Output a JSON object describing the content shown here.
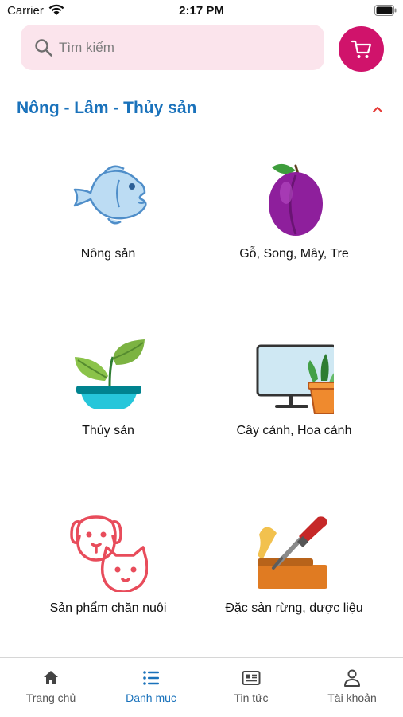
{
  "status_bar": {
    "carrier": "Carrier",
    "time": "2:17 PM"
  },
  "search": {
    "placeholder": "Tìm kiếm"
  },
  "section": {
    "title": "Nông - Lâm - Thủy sản"
  },
  "categories": [
    {
      "label": "Nông sản",
      "icon": "fish-icon"
    },
    {
      "label": "Gỗ, Song, Mây, Tre",
      "icon": "plum-icon"
    },
    {
      "label": "Thủy sản",
      "icon": "potted-plant-icon"
    },
    {
      "label": "Cây cảnh, Hoa cảnh",
      "icon": "monitor-plant-icon"
    },
    {
      "label": "Sản phẩm chăn nuôi",
      "icon": "dog-cat-icon"
    },
    {
      "label": "Đặc sản rừng, dược liệu",
      "icon": "chisel-wood-icon"
    }
  ],
  "tabs": [
    {
      "label": "Trang chủ",
      "icon": "home-icon"
    },
    {
      "label": "Danh mục",
      "icon": "list-icon",
      "active": true
    },
    {
      "label": "Tin tức",
      "icon": "news-icon"
    },
    {
      "label": "Tài khoản",
      "icon": "user-icon"
    }
  ],
  "colors": {
    "accent": "#1a72bb",
    "cart": "#d0136b",
    "search_bg": "#fbe4ec",
    "collapse": "#e53935"
  }
}
